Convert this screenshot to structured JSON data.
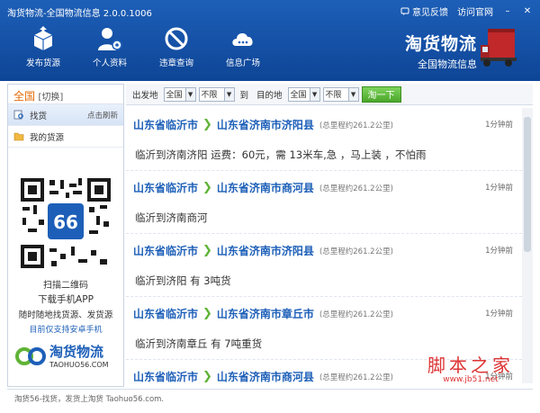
{
  "window": {
    "title": "淘货物流-全国物流信息 2.0.0.1006"
  },
  "topbar": {
    "feedback": "意见反馈",
    "website": "访问官网"
  },
  "nav": [
    {
      "label": "发布货源",
      "icon": "box-upload-icon"
    },
    {
      "label": "个人资料",
      "icon": "user-gear-icon"
    },
    {
      "label": "违章查询",
      "icon": "no-entry-icon"
    },
    {
      "label": "信息广场",
      "icon": "cloud-icon"
    }
  ],
  "brand": {
    "name": "淘货物流",
    "subtitle": "全国物流信息"
  },
  "sidebar": {
    "city": "全国",
    "switch": "[切换]",
    "items": [
      {
        "label": "找货",
        "hint": "点击刷新"
      },
      {
        "label": "我的货源",
        "hint": ""
      }
    ],
    "qr_caption": "扫描二维码",
    "download": "下载手机APP",
    "slogan": "随时随地找货源、发货源",
    "support": "目前仅支持安卓手机",
    "logo_name": "淘货物流",
    "logo_url": "TAOHUO56.COM"
  },
  "filter": {
    "origin_label": "出发地",
    "origin_province": "全国",
    "origin_city": "不限",
    "to_label": "到",
    "dest_label": "目的地",
    "dest_province": "全国",
    "dest_city": "不限",
    "search_button": "淘一下"
  },
  "listings": [
    {
      "from": "山东省临沂市",
      "to": "山东省济南市济阳县",
      "distance": "(总里程约261.2公里)",
      "time": "1分钟前",
      "desc": "临沂到济南济阳 运费：60元，需 13米车,急 ，马上装 ，不怕雨"
    },
    {
      "from": "山东省临沂市",
      "to": "山东省济南市商河县",
      "distance": "(总里程约261.2公里)",
      "time": "1分钟前",
      "desc": "临沂到济南商河"
    },
    {
      "from": "山东省临沂市",
      "to": "山东省济南市济阳县",
      "distance": "(总里程约261.2公里)",
      "time": "1分钟前",
      "desc": "临沂到济阳 有 3吨货"
    },
    {
      "from": "山东省临沂市",
      "to": "山东省济南市章丘市",
      "distance": "(总里程约261.2公里)",
      "time": "1分钟前",
      "desc": "临沂到济南章丘 有 7吨重货"
    },
    {
      "from": "山东省临沂市",
      "to": "山东省济南市商河县",
      "distance": "(总里程约261.2公里)",
      "time": "1分钟前",
      "desc": ""
    }
  ],
  "statusbar": {
    "text": "淘货56-找货，发货上淘货 Taohuo56.com."
  },
  "watermark": {
    "name": "脚本之家",
    "url": "www.jb51.net"
  },
  "colors": {
    "header": "#1d5fb8",
    "accent_green": "#5fb336",
    "city_orange": "#e36c09"
  }
}
